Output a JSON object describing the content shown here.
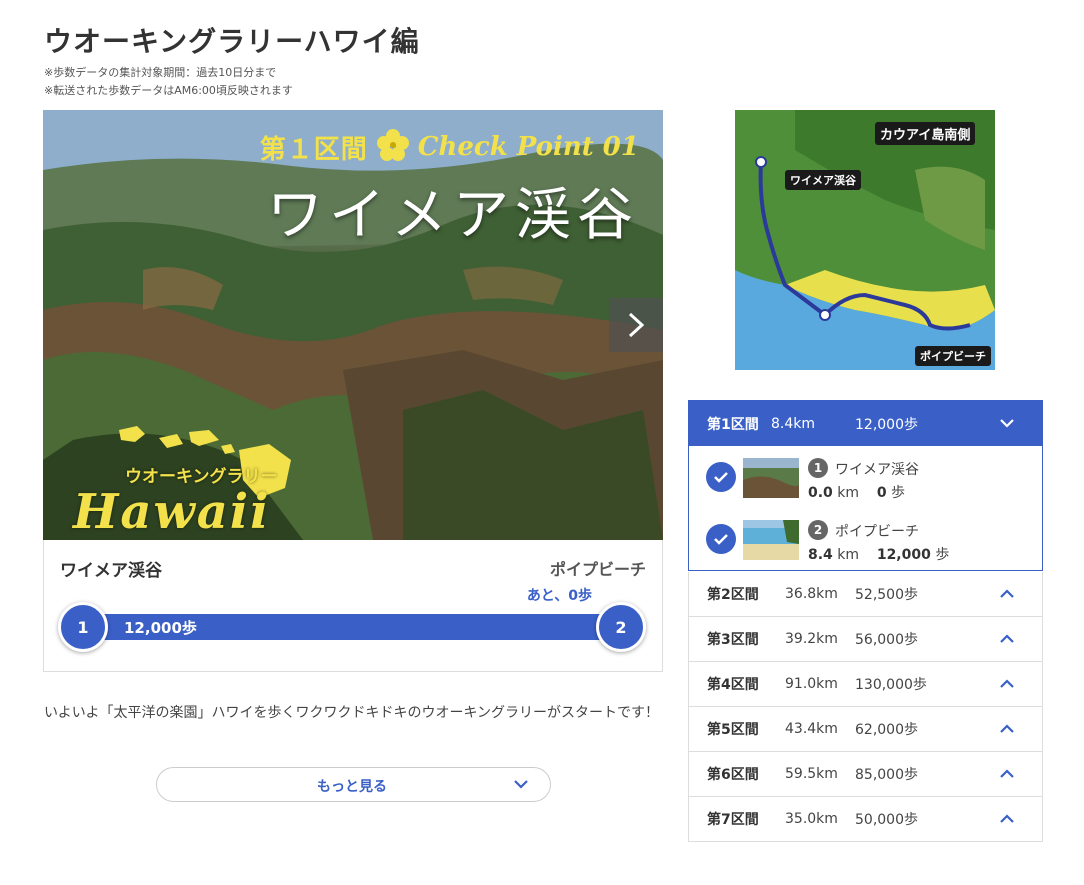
{
  "page": {
    "title": "ウオーキングラリーハワイ編",
    "note1": "※歩数データの集計対象期間：過去10日分まで",
    "note2": "※転送された歩数データはAM6:00頃反映されます"
  },
  "hero": {
    "section_label": "第１区間",
    "checkpoint_label": "Check Point 01",
    "place_name": "ワイメア渓谷",
    "logo_sub": "ウオーキングラリー",
    "logo_main": "Hawaii",
    "next_icon": "chevron-right-icon"
  },
  "progress": {
    "from": "ワイメア渓谷",
    "to": "ポイプビーチ",
    "remaining": "あと、0歩",
    "steps_label": "12,000歩",
    "start_node": "1",
    "end_node": "2",
    "completion": 1.0
  },
  "description": "いよいよ「太平洋の楽園」ハワイを歩くワクワクドキドキのウオーキングラリーがスタートです！",
  "more_button": {
    "label": "もっと見る"
  },
  "map": {
    "title": "カウアイ島南側",
    "label_start": "ワイメア渓谷",
    "label_end": "ポイプビーチ"
  },
  "sections": [
    {
      "name": "第1区間",
      "distance": "8.4km",
      "steps": "12,000歩",
      "expanded": true,
      "checkpoints": [
        {
          "num": "1",
          "name": "ワイメア渓谷",
          "km": "0.0",
          "km_unit": "km",
          "steps": "0",
          "steps_unit": "歩"
        },
        {
          "num": "2",
          "name": "ポイプビーチ",
          "km": "8.4",
          "km_unit": "km",
          "steps": "12,000",
          "steps_unit": "歩"
        }
      ]
    },
    {
      "name": "第2区間",
      "distance": "36.8km",
      "steps": "52,500歩"
    },
    {
      "name": "第3区間",
      "distance": "39.2km",
      "steps": "56,000歩"
    },
    {
      "name": "第4区間",
      "distance": "91.0km",
      "steps": "130,000歩"
    },
    {
      "name": "第5区間",
      "distance": "43.4km",
      "steps": "62,000歩"
    },
    {
      "name": "第6区間",
      "distance": "59.5km",
      "steps": "85,000歩"
    },
    {
      "name": "第7区間",
      "distance": "35.0km",
      "steps": "50,000歩"
    }
  ],
  "colors": {
    "accent": "#3a60c8",
    "logo_yellow": "#f2e14a"
  }
}
